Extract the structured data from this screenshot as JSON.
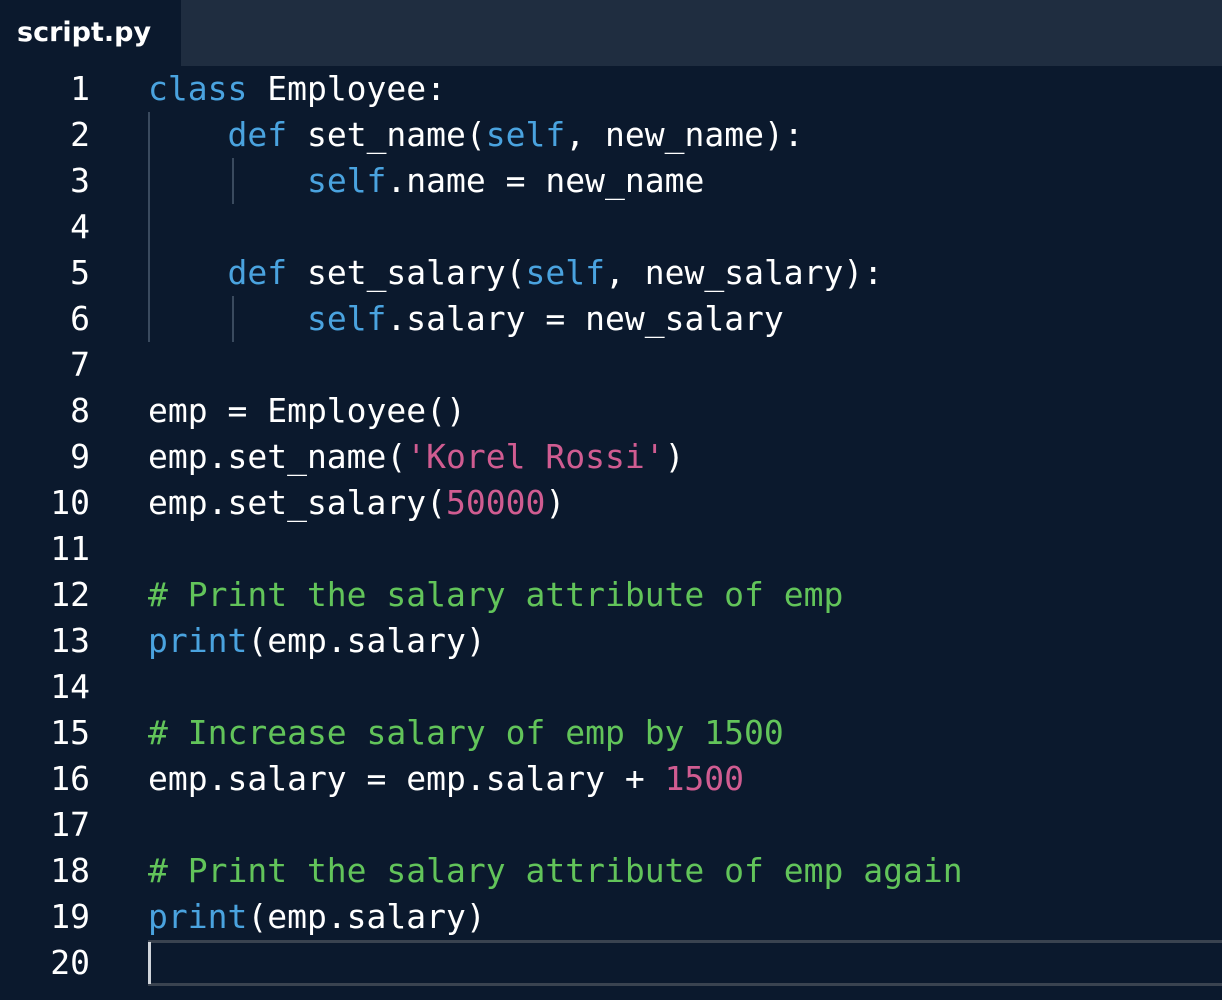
{
  "tab": {
    "title": "script.py"
  },
  "lines": [
    {
      "n": "1",
      "tokens": [
        {
          "t": "class",
          "c": "kw"
        },
        {
          "t": " Employee:",
          "c": ""
        }
      ]
    },
    {
      "n": "2",
      "tokens": [
        {
          "t": "    ",
          "c": ""
        },
        {
          "t": "def",
          "c": "kw"
        },
        {
          "t": " set_name(",
          "c": ""
        },
        {
          "t": "self",
          "c": "kw"
        },
        {
          "t": ", new_name):",
          "c": ""
        }
      ]
    },
    {
      "n": "3",
      "tokens": [
        {
          "t": "        ",
          "c": ""
        },
        {
          "t": "self",
          "c": "kw"
        },
        {
          "t": ".name = new_name",
          "c": ""
        }
      ]
    },
    {
      "n": "4",
      "tokens": []
    },
    {
      "n": "5",
      "tokens": [
        {
          "t": "    ",
          "c": ""
        },
        {
          "t": "def",
          "c": "kw"
        },
        {
          "t": " set_salary(",
          "c": ""
        },
        {
          "t": "self",
          "c": "kw"
        },
        {
          "t": ", new_salary):",
          "c": ""
        }
      ]
    },
    {
      "n": "6",
      "tokens": [
        {
          "t": "        ",
          "c": ""
        },
        {
          "t": "self",
          "c": "kw"
        },
        {
          "t": ".salary = new_salary",
          "c": ""
        }
      ]
    },
    {
      "n": "7",
      "tokens": []
    },
    {
      "n": "8",
      "tokens": [
        {
          "t": "emp = Employee()",
          "c": ""
        }
      ]
    },
    {
      "n": "9",
      "tokens": [
        {
          "t": "emp.set_name(",
          "c": ""
        },
        {
          "t": "'Korel Rossi'",
          "c": "str"
        },
        {
          "t": ")",
          "c": ""
        }
      ]
    },
    {
      "n": "10",
      "tokens": [
        {
          "t": "emp.set_salary(",
          "c": ""
        },
        {
          "t": "50000",
          "c": "num"
        },
        {
          "t": ")",
          "c": ""
        }
      ]
    },
    {
      "n": "11",
      "tokens": []
    },
    {
      "n": "12",
      "tokens": [
        {
          "t": "# Print the salary attribute of emp",
          "c": "com"
        }
      ]
    },
    {
      "n": "13",
      "tokens": [
        {
          "t": "print",
          "c": "kw"
        },
        {
          "t": "(emp.salary)",
          "c": ""
        }
      ]
    },
    {
      "n": "14",
      "tokens": []
    },
    {
      "n": "15",
      "tokens": [
        {
          "t": "# Increase salary of emp by 1500",
          "c": "com"
        }
      ]
    },
    {
      "n": "16",
      "tokens": [
        {
          "t": "emp.salary = emp.salary + ",
          "c": ""
        },
        {
          "t": "1500",
          "c": "num"
        }
      ]
    },
    {
      "n": "17",
      "tokens": []
    },
    {
      "n": "18",
      "tokens": [
        {
          "t": "# Print the salary attribute of emp again",
          "c": "com"
        }
      ]
    },
    {
      "n": "19",
      "tokens": [
        {
          "t": "print",
          "c": "kw"
        },
        {
          "t": "(emp.salary)",
          "c": ""
        }
      ]
    },
    {
      "n": "20",
      "tokens": []
    }
  ],
  "colors": {
    "background": "#0b192d",
    "tabbar": "#1f2d40",
    "keyword": "#4aa3df",
    "string": "#d05c91",
    "number": "#d05c91",
    "comment": "#62c45a",
    "text": "#ffffff"
  }
}
